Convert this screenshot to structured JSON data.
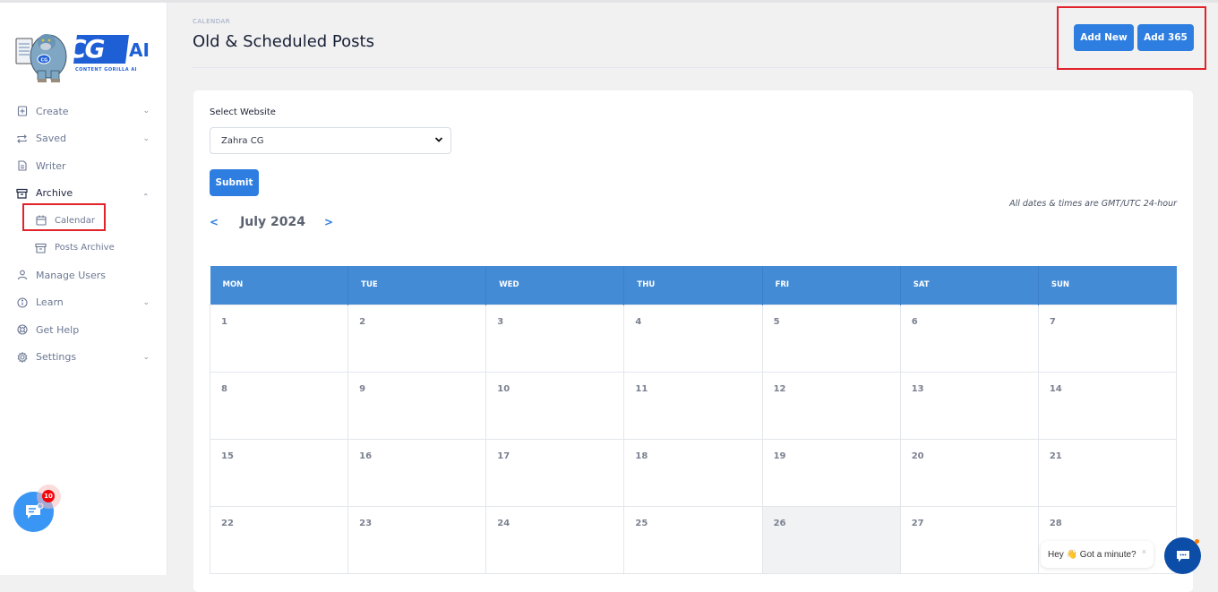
{
  "brand": {
    "logo_text": "CG",
    "logo_suffix": "AI",
    "logo_tagline": "CONTENT GORILLA AI"
  },
  "sidebar": {
    "items": [
      {
        "label": "Create",
        "icon": "file-plus-icon",
        "chevron": "down"
      },
      {
        "label": "Saved",
        "icon": "repeat-icon",
        "chevron": "down"
      },
      {
        "label": "Writer",
        "icon": "document-icon"
      },
      {
        "label": "Archive",
        "icon": "archive-box-icon",
        "chevron": "up",
        "expanded": true
      },
      {
        "label": "Calendar",
        "icon": "calendar-icon",
        "sub": true,
        "active": true
      },
      {
        "label": "Posts Archive",
        "icon": "archive-box-icon",
        "sub": true
      },
      {
        "label": "Manage Users",
        "icon": "user-icon"
      },
      {
        "label": "Learn",
        "icon": "info-circle-icon",
        "chevron": "down"
      },
      {
        "label": "Get Help",
        "icon": "lifebuoy-icon"
      },
      {
        "label": "Settings",
        "icon": "gear-icon",
        "chevron": "down"
      }
    ],
    "chat_badge_count": "10"
  },
  "header": {
    "breadcrumb": "CALENDAR",
    "title": "Old & Scheduled Posts",
    "add_new_label": "Add New",
    "add_365_label": "Add 365"
  },
  "form": {
    "select_label": "Select Website",
    "selected_website": "Zahra CG",
    "submit_label": "Submit"
  },
  "calendar": {
    "timezone_note": "All dates & times are GMT/UTC 24-hour",
    "month_label": "July 2024",
    "prev_label": "<",
    "next_label": ">",
    "weekdays": [
      "MON",
      "TUE",
      "WED",
      "THU",
      "FRI",
      "SAT",
      "SUN"
    ],
    "weeks": [
      [
        "1",
        "2",
        "3",
        "4",
        "5",
        "6",
        "7"
      ],
      [
        "8",
        "9",
        "10",
        "11",
        "12",
        "13",
        "14"
      ],
      [
        "15",
        "16",
        "17",
        "18",
        "19",
        "20",
        "21"
      ],
      [
        "22",
        "23",
        "24",
        "25",
        "26",
        "27",
        "28"
      ]
    ],
    "highlighted_day": "26"
  },
  "chat_widget": {
    "greeting": "Hey 👋 Got a minute?",
    "close_label": "×"
  },
  "colors": {
    "primary": "#2d7ee0",
    "calendar_header": "#448bd6",
    "highlight_box": "#e1232b",
    "chat_left": "#3a96f4",
    "chat_right": "#0c4da8"
  }
}
